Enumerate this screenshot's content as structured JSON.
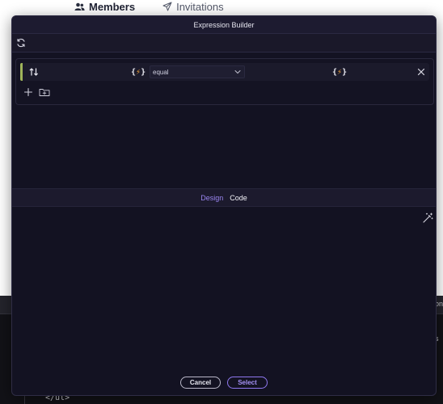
{
  "background": {
    "tabs": [
      {
        "label": "Members",
        "icon": "users-icon",
        "active": true
      },
      {
        "label": "Invitations",
        "icon": "paper-plane-icon",
        "active": false
      }
    ],
    "code_line": "</ul>",
    "side_text_1": "on",
    "side_text_2": "s"
  },
  "modal": {
    "title": "Expression Builder",
    "toolbar": {
      "refresh_icon": "refresh-icon"
    },
    "condition": {
      "operator": "equal",
      "left_expression_icon": "{⚡}",
      "right_expression_icon": "{⚡}"
    },
    "tabs": {
      "design": "Design",
      "code": "Code",
      "active": "design"
    },
    "buttons": {
      "cancel": "Cancel",
      "select": "Select"
    }
  },
  "colors": {
    "modal_bg": "#131222",
    "accent_purple": "#9a86f0",
    "row_accent": "#9fb45a",
    "bolt": "#f2a33a"
  }
}
